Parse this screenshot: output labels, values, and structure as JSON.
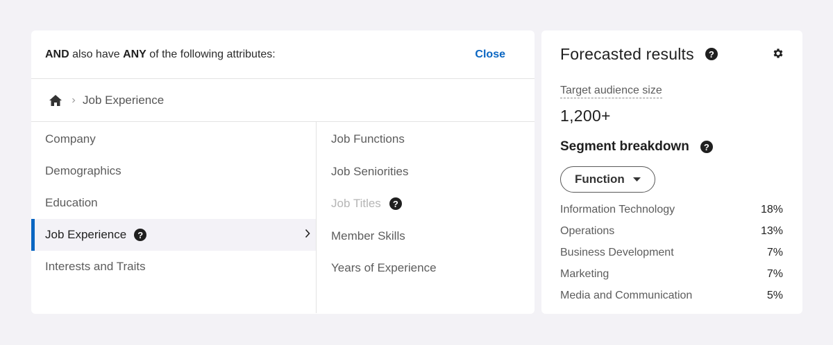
{
  "attributes_panel": {
    "header": {
      "prefix_bold": "AND",
      "middle": " also have ",
      "any_bold": "ANY",
      "suffix": " of the following attributes:",
      "close_label": "Close"
    },
    "breadcrumb": {
      "home_icon": "home-icon",
      "separator_icon": "chevron-right-icon",
      "current": "Job Experience"
    },
    "categories": [
      {
        "label": "Company"
      },
      {
        "label": "Demographics"
      },
      {
        "label": "Education"
      },
      {
        "label": "Job Experience",
        "active": true
      },
      {
        "label": "Interests and Traits"
      }
    ],
    "subcategories": [
      {
        "label": "Job Functions"
      },
      {
        "label": "Job Seniorities"
      },
      {
        "label": "Job Titles",
        "disabled": true
      },
      {
        "label": "Member Skills"
      },
      {
        "label": "Years of Experience"
      }
    ]
  },
  "forecast": {
    "title": "Forecasted results",
    "audience_label": "Target audience size",
    "audience_value": "1,200+",
    "segment_title": "Segment breakdown",
    "filter_label": "Function",
    "breakdown": [
      {
        "label": "Information Technology",
        "value": "18%"
      },
      {
        "label": "Operations",
        "value": "13%"
      },
      {
        "label": "Business Development",
        "value": "7%"
      },
      {
        "label": "Marketing",
        "value": "7%"
      },
      {
        "label": "Media and Communication",
        "value": "5%"
      }
    ]
  },
  "colors": {
    "accent": "#0a66c2",
    "background": "#f3f2f6",
    "active_row": "#f3f2f7"
  }
}
